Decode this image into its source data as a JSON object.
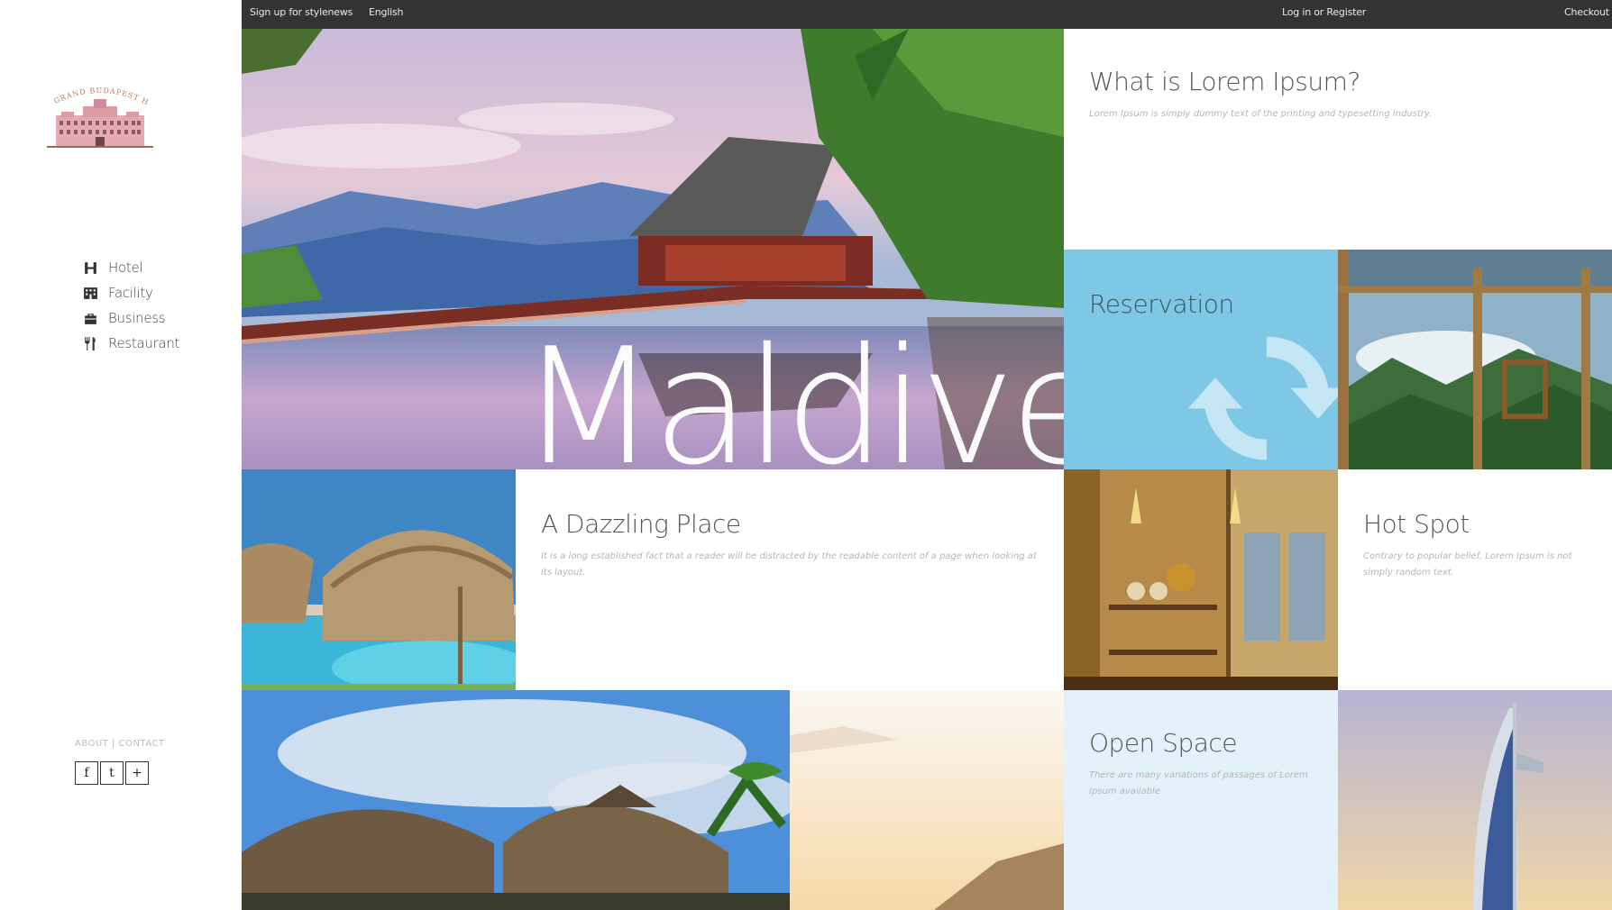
{
  "brand": {
    "logo_alt": "Grand Budapest Hotel"
  },
  "topbar": {
    "signup": "Sign up for stylenews",
    "language": "English",
    "login": "Log in or Register",
    "checkout": "Checkout"
  },
  "nav": {
    "items": [
      {
        "label": "Hotel",
        "icon": "hotel-h-icon"
      },
      {
        "label": "Facility",
        "icon": "building-icon"
      },
      {
        "label": "Business",
        "icon": "briefcase-icon"
      },
      {
        "label": "Restaurant",
        "icon": "cutlery-icon"
      }
    ]
  },
  "footer": {
    "links": "ABOUT | CONTACT"
  },
  "social": {
    "facebook": "f",
    "twitter": "t",
    "plus": "+"
  },
  "hero": {
    "title": "Maldives"
  },
  "lorem_tile": {
    "title": "What is Lorem Ipsum?",
    "text": "Lorem Ipsum is simply dummy text of the printing and typesetting industry."
  },
  "reservation_tile": {
    "title": "Reservation",
    "icon": "refresh-icon"
  },
  "dazzling_tile": {
    "title": "A Dazzling Place",
    "text": "It is a long established fact that a reader will be distracted by the readable content of a page when looking at its layout."
  },
  "hotspot_tile": {
    "title": "Hot Spot",
    "text": "Contrary to popular belief, Lorem Ipsum is not simply random text."
  },
  "openspace_tile": {
    "title": "Open Space",
    "text": "There are many variations of passages of Lorem Ipsum available"
  },
  "colors": {
    "topbar": "#333333",
    "reservation_bg": "#7ec8e6",
    "openspace_bg": "#e3f1fa"
  }
}
